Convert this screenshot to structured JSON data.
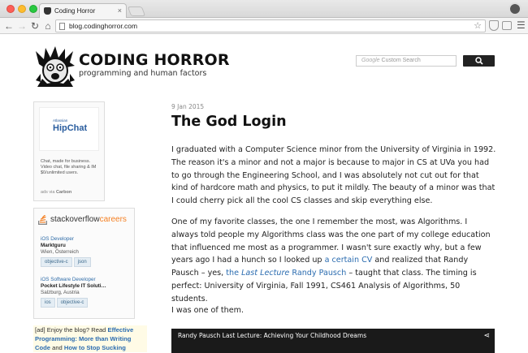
{
  "browser": {
    "tab_title": "Coding Horror",
    "tab_close": "×",
    "url": "blog.codinghorror.com",
    "nav": {
      "back": "←",
      "forward": "→",
      "reload": "↻",
      "home": "⌂"
    },
    "star": "☆",
    "menu": "☰"
  },
  "header": {
    "title": "CODING HORROR",
    "subtitle": "programming and human factors",
    "search_placeholder": "Custom Search",
    "search_brand": "Google"
  },
  "sidebar": {
    "carbon_ad": {
      "brand_small": "Atlassian",
      "brand": "HipChat",
      "text": "Chat, made for business. Video chat, file sharing & IM $0/unlimited users.",
      "via_prefix": "ads via",
      "via_name": "Carbon"
    },
    "jobs": {
      "logo_main": "stackoverflow",
      "logo_careers": "careers",
      "items": [
        {
          "title": "iOS Developer",
          "company": "Marktguru",
          "location": "Wien, Österreich",
          "tags": [
            "objective-c",
            "json"
          ]
        },
        {
          "title": "iOS Software Developer",
          "company": "Pocket Lifestyle IT Soluti…",
          "location": "Salzburg, Austria",
          "tags": [
            "ios",
            "objective-c"
          ]
        }
      ]
    },
    "ad_text": {
      "prefix": "[ad] Enjoy the blog? Read",
      "link1": "Effective Programming: More than Writing Code",
      "middle": "and",
      "link2": "How to Stop Sucking"
    }
  },
  "post": {
    "date": "9 Jan 2015",
    "title": "The God Login",
    "p1": "I graduated with a Computer Science minor from the University of Virginia in 1992. The reason it's a minor and not a major is because to major in CS at UVa you had to go through the Engineering School, and I was absolutely not cut out for that kind of hardcore math and physics, to put it mildly. The beauty of a minor was that I could cherry pick all the cool CS classes and skip everything else.",
    "p2_a": "One of my favorite classes, the one I remember the most, was Algorithms. I always told people my Algorithms class was the one part of my college education that influenced me most as a programmer. I wasn't sure exactly why, but a few years ago I had a hunch so I looked up",
    "p2_link1": "a certain CV",
    "p2_b": "and realized that Randy Pausch – yes,",
    "p2_link2_pre": "the",
    "p2_link2_italic": "Last Lecture",
    "p2_link2_post": "Randy Pausch",
    "p2_c": "– taught that class. The timing is perfect: University of Virginia, Fall 1991, CS461 Analysis of Algorithms, 50 students.",
    "p3": "I was one of them.",
    "video_title": "Randy Pausch Last Lecture: Achieving Your Childhood Dreams"
  }
}
